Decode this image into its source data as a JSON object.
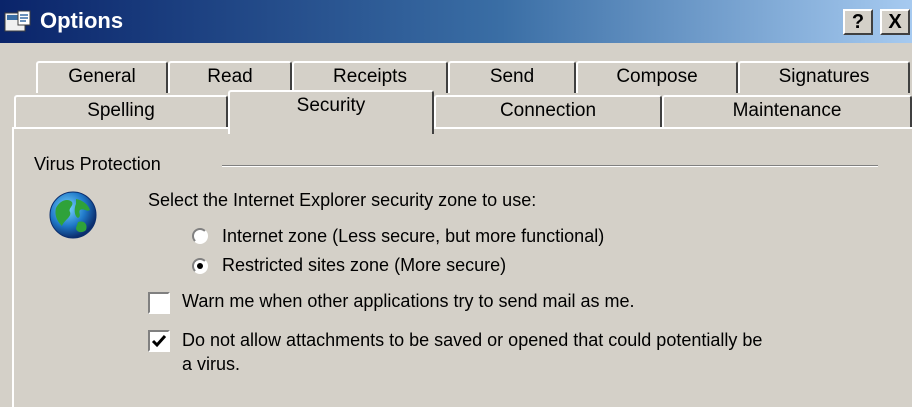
{
  "window": {
    "title": "Options",
    "help_button": "?",
    "close_button": "X"
  },
  "tabs": {
    "row1": [
      "General",
      "Read",
      "Receipts",
      "Send",
      "Compose",
      "Signatures"
    ],
    "row2": [
      "Spelling",
      "Security",
      "Connection",
      "Maintenance"
    ],
    "active": "Security"
  },
  "virus_protection": {
    "group_label": "Virus Protection",
    "zone_prompt": "Select the Internet Explorer security zone to use:",
    "zone_options": [
      {
        "label": "Internet zone (Less secure, but more functional)",
        "selected": false
      },
      {
        "label": "Restricted sites zone (More secure)",
        "selected": true
      }
    ],
    "warn_checkbox": {
      "label": "Warn me when other applications try to send mail as me.",
      "checked": false
    },
    "attachments_checkbox": {
      "label_line1": "Do not allow attachments to be saved or opened that could potentially be",
      "label_line2": "a virus.",
      "checked": true
    }
  },
  "icons": [
    "options-window-icon",
    "globe-icon"
  ]
}
